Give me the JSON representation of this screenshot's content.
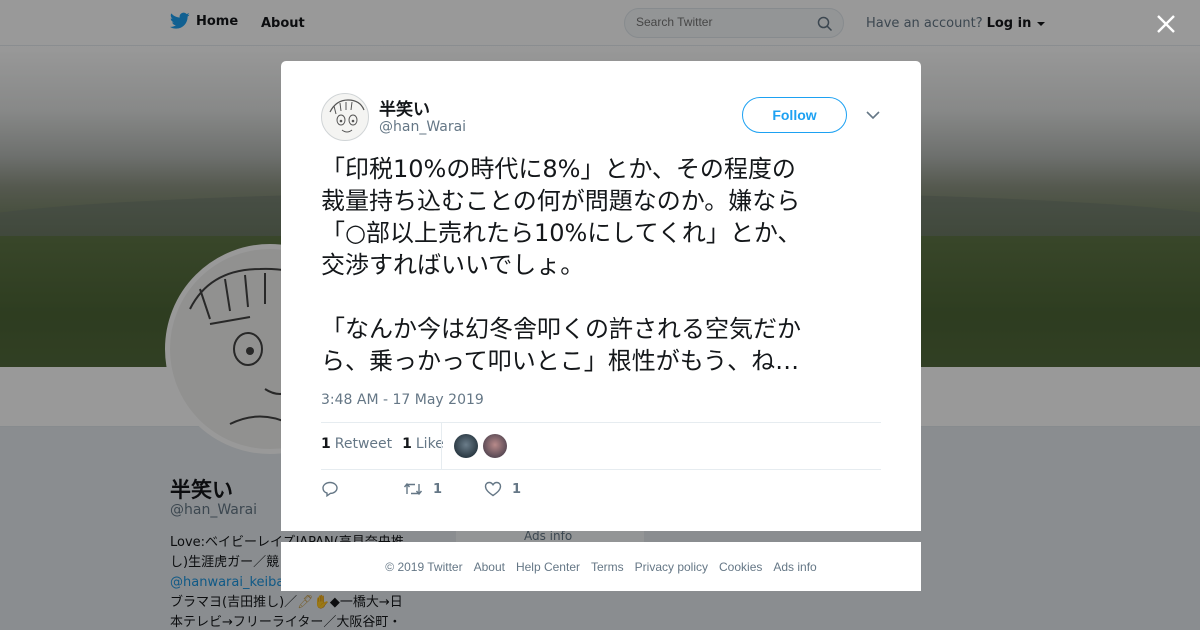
{
  "nav": {
    "home_label": "Home",
    "about_label": "About",
    "search_placeholder": "Search Twitter",
    "account_prompt": "Have an account?",
    "login_label": "Log in"
  },
  "profile": {
    "name": "半笑い",
    "handle": "@han_Warai",
    "bio_line1": "Love:ベイビーレイズJAPAN(高見奈央推",
    "bio_line2": "し)生涯虎ガー／競",
    "bio_link": "@hanwarai_keiba",
    "bio_line4": "ブラマヨ(吉田推し)／",
    "bio_line4b": "◆一橋大→日",
    "bio_line5": "本テレビ→フリーライター／大阪谷町・",
    "ads_label": "Ads info"
  },
  "tweet": {
    "author_name": "半笑い",
    "author_handle": "@han_Warai",
    "follow_label": "Follow",
    "text": "「印税10%の時代に8%」とか、その程度の\n裁量持ち込むことの何が問題なのか。嫌なら\n「○部以上売れたら10%にしてくれ」とか、\n交渉すればいいでしょ。\n\n「なんか今は幻冬舎叩くの許される空気だか\nら、乗っかって叩いとこ」根性がもう、ね…",
    "timestamp": "3:48 AM - 17 May 2019",
    "retweet_count": "1",
    "retweet_label": "Retweet",
    "like_count": "1",
    "like_label": "Like",
    "action_retweet_count": "1",
    "action_like_count": "1"
  },
  "footer": {
    "links": [
      "© 2019 Twitter",
      "About",
      "Help Center",
      "Terms",
      "Privacy policy",
      "Cookies",
      "Ads info"
    ]
  },
  "colors": {
    "brand": "#1da1f2",
    "overlay": "rgba(0,0,0,0.4)",
    "text_secondary": "#657786"
  },
  "icons": [
    "twitter-bird-icon",
    "search-icon",
    "close-icon",
    "chevron-down-icon",
    "reply-icon",
    "retweet-icon",
    "heart-icon"
  ]
}
